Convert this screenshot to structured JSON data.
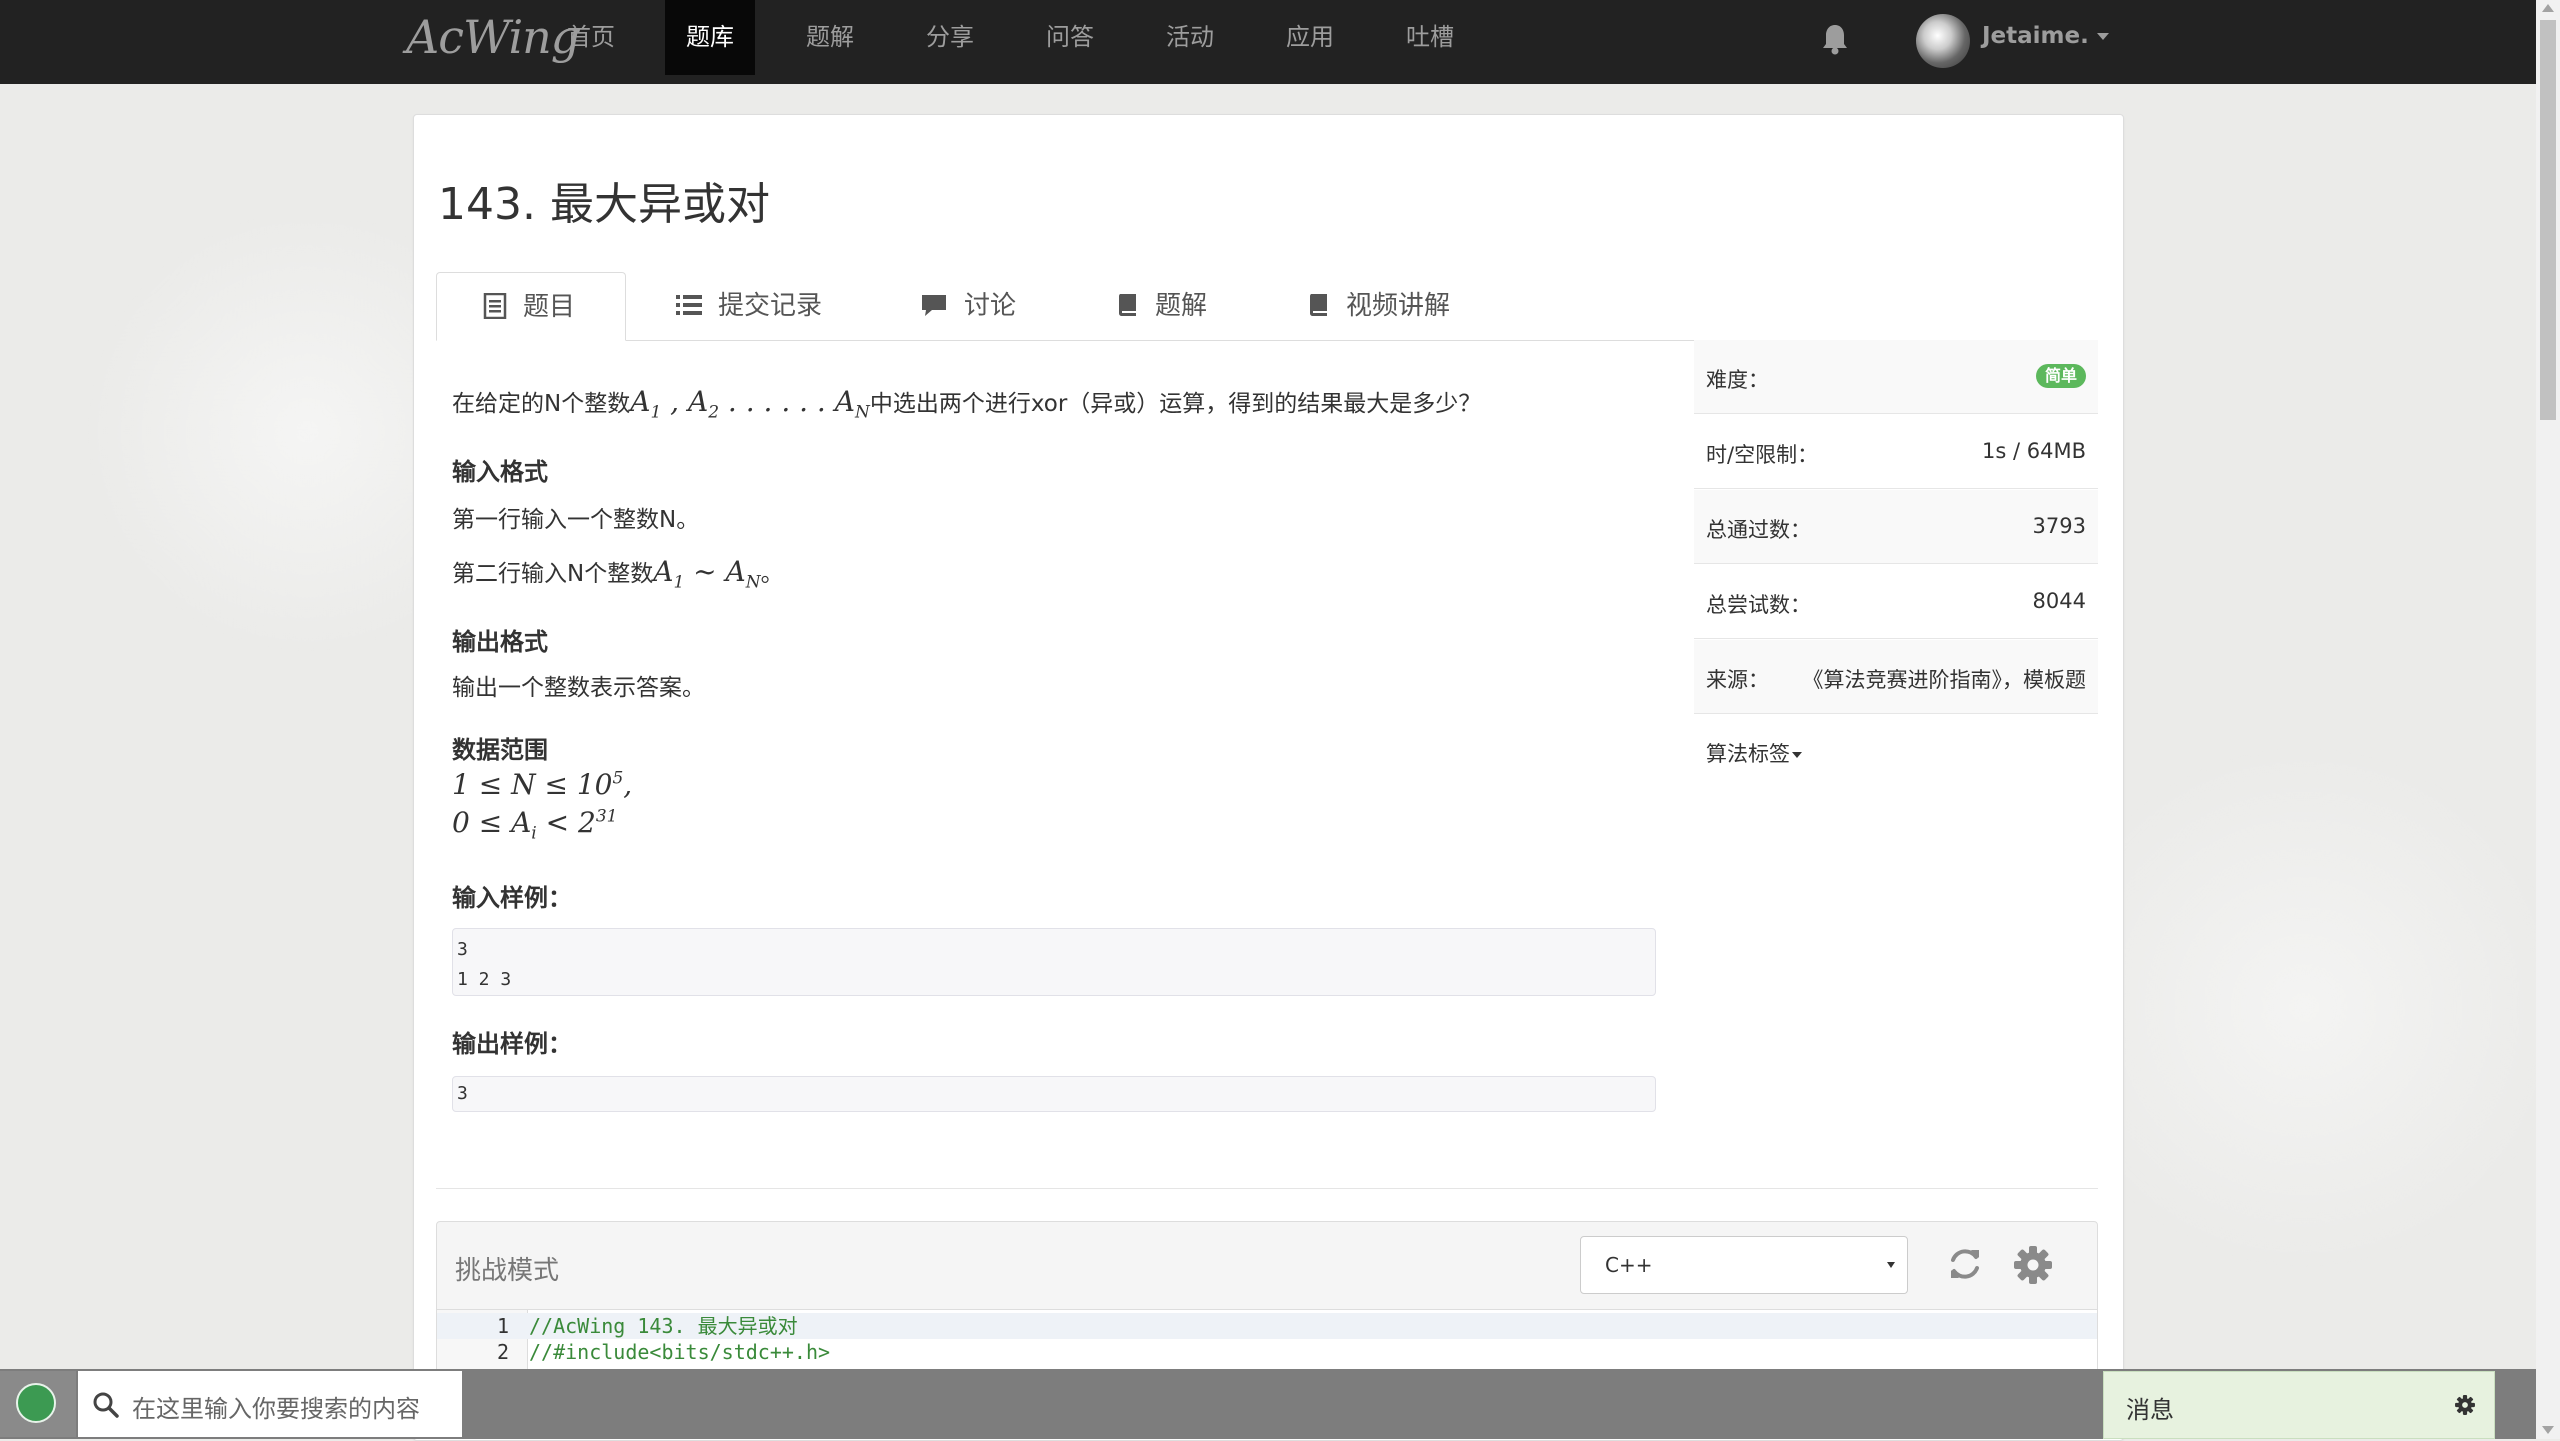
{
  "nav": {
    "logo": "AcWing",
    "items": [
      "首页",
      "题库",
      "题解",
      "分享",
      "问答",
      "活动",
      "应用",
      "吐槽"
    ],
    "active_index": 1,
    "username": "Jetaime."
  },
  "problem": {
    "title": "143. 最大异或对",
    "tabs": [
      "题目",
      "提交记录",
      "讨论",
      "题解",
      "视频讲解"
    ],
    "description_prefix": "在给定的N个整数",
    "description_math": "A₁，A₂……Aₙ",
    "description_suffix": "中选出两个进行xor（异或）运算，得到的结果最大是多少？",
    "input_format_heading": "输入格式",
    "input_line1": "第一行输入一个整数N。",
    "input_line2_prefix": "第二行输入N个整数",
    "input_line2_suffix": "。",
    "output_format_heading": "输出格式",
    "output_line1": "输出一个整数表示答案。",
    "range_heading": "数据范围",
    "sample_input_heading": "输入样例：",
    "sample_input": "3\n1 2 3",
    "sample_output_heading": "输出样例：",
    "sample_output": "3"
  },
  "info": {
    "difficulty_label": "难度：",
    "difficulty_value": "简单",
    "limit_label": "时/空限制：",
    "limit_value": "1s / 64MB",
    "passed_label": "总通过数：",
    "passed_value": "3793",
    "tried_label": "总尝试数：",
    "tried_value": "8044",
    "source_label": "来源：",
    "source_value": "《算法竞赛进阶指南》，模板题",
    "tags_label": "算法标签"
  },
  "editor": {
    "mode_label": "挑战模式",
    "language": "C++",
    "lines": [
      {
        "n": "1",
        "text": "//AcWing 143. 最大异或对"
      },
      {
        "n": "2",
        "text": "//#include<bits/stdc++.h>"
      }
    ]
  },
  "taskbar": {
    "search_placeholder": "在这里输入你要搜索的内容",
    "message_label": "消息"
  },
  "colors": {
    "navbar": "#222222",
    "badge": "#5cb85c",
    "code_comment": "#3a8a3a"
  }
}
